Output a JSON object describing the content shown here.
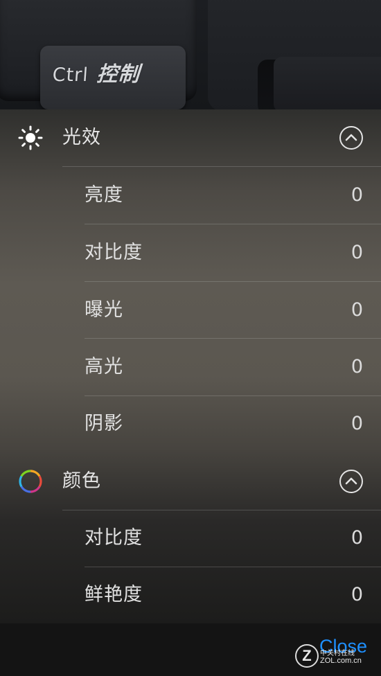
{
  "photo": {
    "key_label_latin": "Ctrl",
    "key_label_cn": "控制"
  },
  "sections": [
    {
      "title": "光效",
      "icon": "sun-icon",
      "items": [
        {
          "label": "亮度",
          "value": "0"
        },
        {
          "label": "对比度",
          "value": "0"
        },
        {
          "label": "曝光",
          "value": "0"
        },
        {
          "label": "高光",
          "value": "0"
        },
        {
          "label": "阴影",
          "value": "0"
        }
      ]
    },
    {
      "title": "颜色",
      "icon": "color-wheel-icon",
      "items": [
        {
          "label": "对比度",
          "value": "0"
        },
        {
          "label": "鲜艳度",
          "value": "0"
        }
      ]
    }
  ],
  "bottom_bar": {
    "close_label": "Close"
  },
  "watermark": {
    "letter": "Z",
    "name": "中关村在线",
    "url": "ZOL.com.cn"
  },
  "colors": {
    "accent": "#1e90ff",
    "text": "#e4e4e4"
  }
}
